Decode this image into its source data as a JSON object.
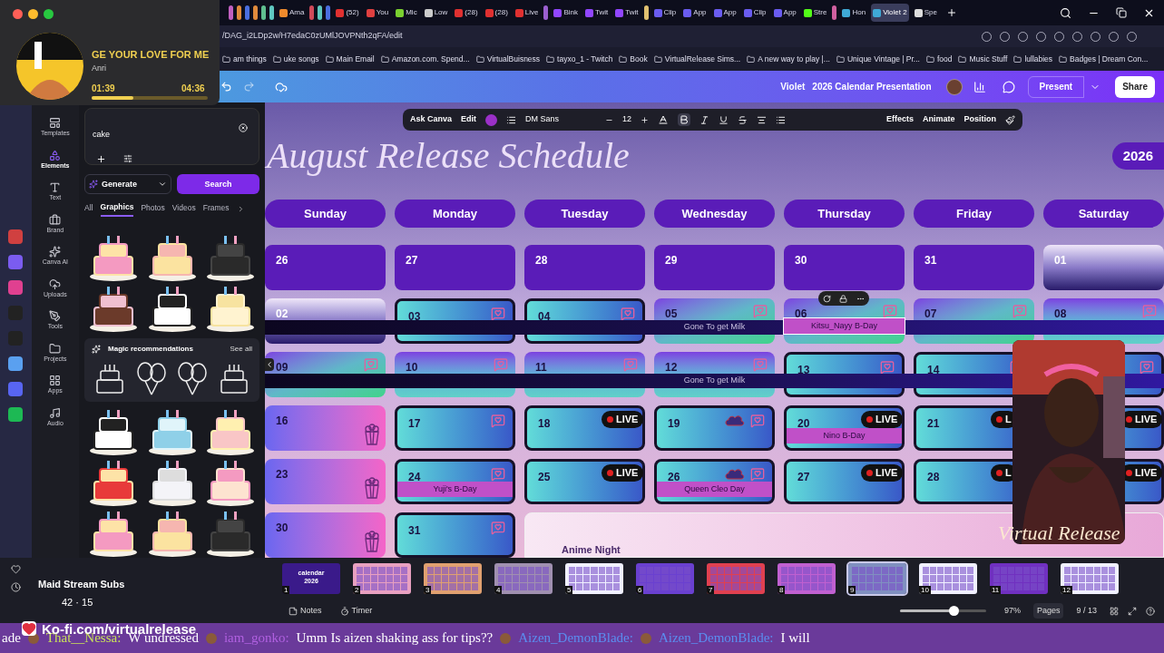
{
  "browser": {
    "tabs": [
      {
        "kind": "group",
        "color": "#c05fc0"
      },
      {
        "kind": "group",
        "color": "#e08a3c"
      },
      {
        "kind": "group",
        "color": "#4a6ee0"
      },
      {
        "kind": "group",
        "color": "#e08a3c"
      },
      {
        "kind": "group",
        "color": "#5fbf8f"
      },
      {
        "kind": "group",
        "color": "#5fc8c0"
      },
      {
        "kind": "tab",
        "label": "Ama",
        "color": "#f08a2c",
        "selected": false
      },
      {
        "kind": "group",
        "color": "#d04a5a"
      },
      {
        "kind": "group",
        "color": "#5fc8c0"
      },
      {
        "kind": "group",
        "color": "#4a6ee0"
      },
      {
        "kind": "tab",
        "label": "(52)",
        "color": "#e03030",
        "selected": false
      },
      {
        "kind": "tab",
        "label": "You",
        "color": "#e04040",
        "selected": false
      },
      {
        "kind": "tab",
        "label": "Mic",
        "color": "#7ad030",
        "selected": false
      },
      {
        "kind": "tab",
        "label": "Low",
        "color": "#cccccc",
        "selected": false
      },
      {
        "kind": "tab",
        "label": "(28)",
        "color": "#e03030",
        "selected": false
      },
      {
        "kind": "tab",
        "label": "(28)",
        "color": "#e03030",
        "selected": false
      },
      {
        "kind": "tab",
        "label": "Live",
        "color": "#e03030",
        "selected": false
      },
      {
        "kind": "group",
        "color": "#9b5fd0"
      },
      {
        "kind": "tab",
        "label": "Bink",
        "color": "#9146ff",
        "selected": false
      },
      {
        "kind": "tab",
        "label": "Twit",
        "color": "#9146ff",
        "selected": false
      },
      {
        "kind": "tab",
        "label": "Twit",
        "color": "#9146ff",
        "selected": false
      },
      {
        "kind": "group",
        "color": "#e0c070"
      },
      {
        "kind": "tab",
        "label": "Clip",
        "color": "#6a5cf0",
        "selected": false
      },
      {
        "kind": "tab",
        "label": "App",
        "color": "#6a5cf0",
        "selected": false
      },
      {
        "kind": "tab",
        "label": "App",
        "color": "#6a5cf0",
        "selected": false
      },
      {
        "kind": "tab",
        "label": "Clip",
        "color": "#6a5cf0",
        "selected": false
      },
      {
        "kind": "tab",
        "label": "App",
        "color": "#6a5cf0",
        "selected": false
      },
      {
        "kind": "tab",
        "label": "Stre",
        "color": "#53fc18",
        "selected": false
      },
      {
        "kind": "group",
        "color": "#d060a0"
      },
      {
        "kind": "tab",
        "label": "Hon",
        "color": "#3fa9d6",
        "selected": false
      },
      {
        "kind": "tab",
        "label": "Violet 2",
        "color": "#3fa9d6",
        "selected": true
      },
      {
        "kind": "tab",
        "label": "Spe",
        "color": "#dddddd",
        "selected": false
      }
    ],
    "url": "/DAG_i2LDp2w/H7edaC0zUMlJOVPNth2qFA/edit",
    "bookmarks": [
      "am things",
      "uke songs",
      "Main Email",
      "Amazon.com. Spend...",
      "VirtualBuisness",
      "tayxo_1 - Twitch",
      "Book",
      "VirtualRelease Sims...",
      "A new way to play |...",
      "Unique Vintage | Pr...",
      "food",
      "Music Stuff",
      "lullabies",
      "Badges | Dream Con..."
    ]
  },
  "music_player": {
    "title": "GE YOUR LOVE FOR ME",
    "artist": "Anri",
    "elapsed": "01:39",
    "total": "04:36",
    "level": 0.36
  },
  "header": {
    "owner": "Violet",
    "title": "2026 Calendar Presentation",
    "present": "Present",
    "share": "Share"
  },
  "side_nav": [
    {
      "label": "Templates",
      "selected": false
    },
    {
      "label": "Elements",
      "selected": true
    },
    {
      "label": "Text",
      "selected": false
    },
    {
      "label": "Brand",
      "selected": false
    },
    {
      "label": "Canva AI",
      "selected": false
    },
    {
      "label": "Uploads",
      "selected": false
    },
    {
      "label": "Tools",
      "selected": false
    },
    {
      "label": "Projects",
      "selected": false
    },
    {
      "label": "Apps",
      "selected": false
    },
    {
      "label": "Audio",
      "selected": false
    }
  ],
  "panel": {
    "search": "cake",
    "generate": "Generate",
    "search_button": "Search",
    "filters": [
      {
        "label": "All",
        "selected": false
      },
      {
        "label": "Graphics",
        "selected": true
      },
      {
        "label": "Photos",
        "selected": false
      },
      {
        "label": "Videos",
        "selected": false
      },
      {
        "label": "Frames",
        "selected": false
      }
    ],
    "magic": {
      "title": "Magic recommendations",
      "see_all": "See all"
    }
  },
  "toolbar": {
    "ask": "Ask Canva",
    "edit": "Edit",
    "font": "DM Sans",
    "size": "12",
    "bold": true,
    "effects": "Effects",
    "animate": "Animate",
    "position": "Position"
  },
  "calendar": {
    "title": "August Release Schedule",
    "year": "2026",
    "days": [
      "Sunday",
      "Monday",
      "Tuesday",
      "Wednesday",
      "Thursday",
      "Friday",
      "Saturday"
    ],
    "weeks": [
      {
        "cells": [
          {
            "day": "26",
            "kind": "purple"
          },
          {
            "day": "27",
            "kind": "purple"
          },
          {
            "day": "28",
            "kind": "purple"
          },
          {
            "day": "29",
            "kind": "purple"
          },
          {
            "day": "30",
            "kind": "purple"
          },
          {
            "day": "31",
            "kind": "purple"
          },
          {
            "day": "01",
            "kind": "fade"
          }
        ]
      },
      {
        "banner": "Gone To get Milk",
        "cells": [
          {
            "day": "02",
            "kind": "fade"
          },
          {
            "day": "03",
            "kind": "teal"
          },
          {
            "day": "04",
            "kind": "teal"
          },
          {
            "day": "05",
            "kind": "green"
          },
          {
            "day": "06",
            "kind": "green",
            "event": {
              "text": "Kitsu_Nayy B-Day",
              "selected": true
            }
          },
          {
            "day": "07",
            "kind": "green"
          },
          {
            "day": "08",
            "kind": "violet"
          }
        ]
      },
      {
        "banner": "Gone To get Milk",
        "cells": [
          {
            "day": "09",
            "kind": "green"
          },
          {
            "day": "10",
            "kind": "violet"
          },
          {
            "day": "11",
            "kind": "violet"
          },
          {
            "day": "12",
            "kind": "violet"
          },
          {
            "day": "13",
            "kind": "teal"
          },
          {
            "day": "14",
            "kind": "teal"
          },
          {
            "kind": "teal"
          }
        ]
      },
      {
        "cells": [
          {
            "day": "16",
            "kind": "pink"
          },
          {
            "day": "17",
            "kind": "teal"
          },
          {
            "day": "18",
            "kind": "teal",
            "live": "LIVE"
          },
          {
            "day": "19",
            "kind": "teal",
            "cloud": true
          },
          {
            "day": "20",
            "kind": "teal",
            "live": "LIVE",
            "event": {
              "text": "Nino B-Day",
              "selected": false
            }
          },
          {
            "day": "21",
            "kind": "teal",
            "live": "L"
          },
          {
            "kind": "teal",
            "live": "LIVE"
          }
        ]
      },
      {
        "cells": [
          {
            "day": "23",
            "kind": "pink"
          },
          {
            "day": "24",
            "kind": "teal",
            "event": {
              "text": "Yuji's B-Day",
              "selected": false
            }
          },
          {
            "day": "25",
            "kind": "teal",
            "live": "LIVE"
          },
          {
            "day": "26",
            "kind": "teal",
            "cloud": true,
            "event": {
              "text": "Queen Cleo Day",
              "selected": false
            }
          },
          {
            "day": "27",
            "kind": "teal",
            "live": "LIVE"
          },
          {
            "day": "28",
            "kind": "teal",
            "live": "L"
          },
          {
            "kind": "teal",
            "live": "LIVE"
          }
        ]
      },
      {
        "cells": [
          {
            "day": "30",
            "kind": "pink"
          },
          {
            "day": "31",
            "kind": "teal"
          }
        ],
        "card": "Anime Night"
      }
    ]
  },
  "pages": [
    {
      "label": "1",
      "title": "calendar 2026",
      "color": "#3a1a8a",
      "selected": false
    },
    {
      "label": "2",
      "color": "#e8a0c0",
      "selected": false
    },
    {
      "label": "3",
      "color": "#e0a070",
      "selected": false
    },
    {
      "label": "4",
      "color": "#a090b0",
      "selected": false
    },
    {
      "label": "5",
      "color": "#f0f0ff",
      "selected": false
    },
    {
      "label": "6",
      "color": "#6a40d0",
      "selected": false
    },
    {
      "label": "7",
      "color": "#e04050",
      "selected": false
    },
    {
      "label": "8",
      "color": "#c060d0",
      "selected": false
    },
    {
      "label": "9",
      "color": "#8090c0",
      "selected": true
    },
    {
      "label": "10",
      "color": "#f0f0ff",
      "selected": false
    },
    {
      "label": "11",
      "color": "#7030c0",
      "selected": false
    },
    {
      "label": "12",
      "color": "#f0f0ff",
      "selected": false
    }
  ],
  "footer": {
    "notes": "Notes",
    "timer": "Timer",
    "zoom": "97%",
    "zoom_slider": {
      "level": 0.62
    },
    "pages": "Pages",
    "page_count": "9 / 13"
  },
  "overlay": {
    "kofi": "Ko-fi.com/virtualrelease",
    "subs_title": "Maid Stream Subs",
    "subs_count": "42 · 15",
    "brand": "Virtual Release"
  },
  "ticker": [
    {
      "kind": "text",
      "text": "ade"
    },
    {
      "kind": "name",
      "text": "That__Nessa:",
      "color": "#c8e05a"
    },
    {
      "kind": "text",
      "text": "W undressed"
    },
    {
      "kind": "name",
      "text": "iam_gonko:",
      "color": "#b060e0"
    },
    {
      "kind": "text",
      "text": "Umm Is aizen shaking ass for tips??"
    },
    {
      "kind": "name",
      "text": "Aizen_DemonBlade:",
      "color": "#5a8ef0"
    },
    {
      "kind": "name",
      "text": "Aizen_DemonBlade:",
      "color": "#5a8ef0"
    },
    {
      "kind": "text",
      "text": "I will"
    }
  ]
}
